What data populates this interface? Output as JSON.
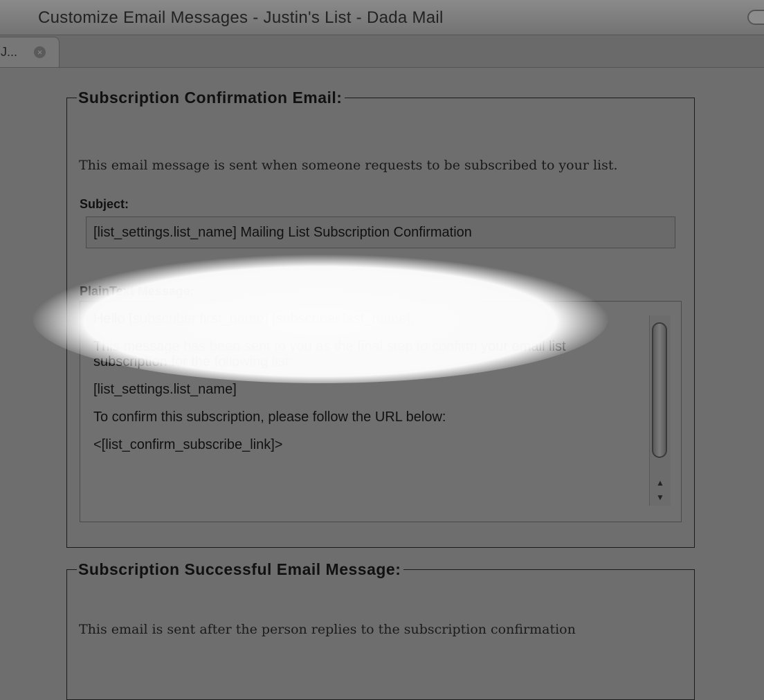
{
  "window": {
    "title": "Customize Email Messages - Justin's List - Dada Mail"
  },
  "tab": {
    "label": "J...",
    "close_glyph": "×"
  },
  "confirmation_section": {
    "legend": "Subscription Confirmation Email:",
    "description": "This email message is sent when someone requests to be subscribed to your list.",
    "subject_label": "Subject:",
    "subject_value": "[list_settings.list_name] Mailing List Subscription Confirmation",
    "message_label": "PlainText Message:",
    "message_lines": {
      "l1": "Hello [subscriber.first_name] [subscriber.last_name],",
      "l2": "This message has been sent to you as the final step to confirm your email list subscription for the following list:",
      "l3": "[list_settings.list_name]",
      "l4": "To confirm this subscription, please follow the URL below:",
      "l5": "<[list_confirm_subscribe_link]>"
    }
  },
  "successful_section": {
    "legend": "Subscription Successful Email Message:",
    "description": "This email is sent after the person replies to the subscription confirmation"
  },
  "scrollbar": {
    "up_glyph": "▲",
    "down_glyph": "▼"
  }
}
